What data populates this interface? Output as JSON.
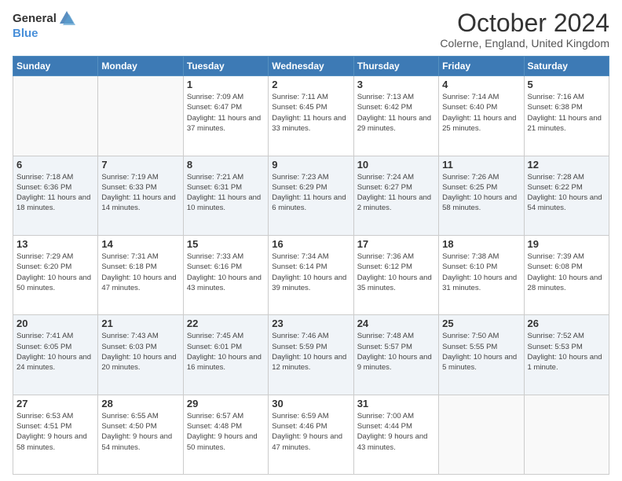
{
  "header": {
    "logo_general": "General",
    "logo_blue": "Blue",
    "title": "October 2024",
    "subtitle": "Colerne, England, United Kingdom"
  },
  "days_of_week": [
    "Sunday",
    "Monday",
    "Tuesday",
    "Wednesday",
    "Thursday",
    "Friday",
    "Saturday"
  ],
  "weeks": [
    [
      {
        "day": "",
        "info": ""
      },
      {
        "day": "",
        "info": ""
      },
      {
        "day": "1",
        "info": "Sunrise: 7:09 AM\nSunset: 6:47 PM\nDaylight: 11 hours and 37 minutes."
      },
      {
        "day": "2",
        "info": "Sunrise: 7:11 AM\nSunset: 6:45 PM\nDaylight: 11 hours and 33 minutes."
      },
      {
        "day": "3",
        "info": "Sunrise: 7:13 AM\nSunset: 6:42 PM\nDaylight: 11 hours and 29 minutes."
      },
      {
        "day": "4",
        "info": "Sunrise: 7:14 AM\nSunset: 6:40 PM\nDaylight: 11 hours and 25 minutes."
      },
      {
        "day": "5",
        "info": "Sunrise: 7:16 AM\nSunset: 6:38 PM\nDaylight: 11 hours and 21 minutes."
      }
    ],
    [
      {
        "day": "6",
        "info": "Sunrise: 7:18 AM\nSunset: 6:36 PM\nDaylight: 11 hours and 18 minutes."
      },
      {
        "day": "7",
        "info": "Sunrise: 7:19 AM\nSunset: 6:33 PM\nDaylight: 11 hours and 14 minutes."
      },
      {
        "day": "8",
        "info": "Sunrise: 7:21 AM\nSunset: 6:31 PM\nDaylight: 11 hours and 10 minutes."
      },
      {
        "day": "9",
        "info": "Sunrise: 7:23 AM\nSunset: 6:29 PM\nDaylight: 11 hours and 6 minutes."
      },
      {
        "day": "10",
        "info": "Sunrise: 7:24 AM\nSunset: 6:27 PM\nDaylight: 11 hours and 2 minutes."
      },
      {
        "day": "11",
        "info": "Sunrise: 7:26 AM\nSunset: 6:25 PM\nDaylight: 10 hours and 58 minutes."
      },
      {
        "day": "12",
        "info": "Sunrise: 7:28 AM\nSunset: 6:22 PM\nDaylight: 10 hours and 54 minutes."
      }
    ],
    [
      {
        "day": "13",
        "info": "Sunrise: 7:29 AM\nSunset: 6:20 PM\nDaylight: 10 hours and 50 minutes."
      },
      {
        "day": "14",
        "info": "Sunrise: 7:31 AM\nSunset: 6:18 PM\nDaylight: 10 hours and 47 minutes."
      },
      {
        "day": "15",
        "info": "Sunrise: 7:33 AM\nSunset: 6:16 PM\nDaylight: 10 hours and 43 minutes."
      },
      {
        "day": "16",
        "info": "Sunrise: 7:34 AM\nSunset: 6:14 PM\nDaylight: 10 hours and 39 minutes."
      },
      {
        "day": "17",
        "info": "Sunrise: 7:36 AM\nSunset: 6:12 PM\nDaylight: 10 hours and 35 minutes."
      },
      {
        "day": "18",
        "info": "Sunrise: 7:38 AM\nSunset: 6:10 PM\nDaylight: 10 hours and 31 minutes."
      },
      {
        "day": "19",
        "info": "Sunrise: 7:39 AM\nSunset: 6:08 PM\nDaylight: 10 hours and 28 minutes."
      }
    ],
    [
      {
        "day": "20",
        "info": "Sunrise: 7:41 AM\nSunset: 6:05 PM\nDaylight: 10 hours and 24 minutes."
      },
      {
        "day": "21",
        "info": "Sunrise: 7:43 AM\nSunset: 6:03 PM\nDaylight: 10 hours and 20 minutes."
      },
      {
        "day": "22",
        "info": "Sunrise: 7:45 AM\nSunset: 6:01 PM\nDaylight: 10 hours and 16 minutes."
      },
      {
        "day": "23",
        "info": "Sunrise: 7:46 AM\nSunset: 5:59 PM\nDaylight: 10 hours and 12 minutes."
      },
      {
        "day": "24",
        "info": "Sunrise: 7:48 AM\nSunset: 5:57 PM\nDaylight: 10 hours and 9 minutes."
      },
      {
        "day": "25",
        "info": "Sunrise: 7:50 AM\nSunset: 5:55 PM\nDaylight: 10 hours and 5 minutes."
      },
      {
        "day": "26",
        "info": "Sunrise: 7:52 AM\nSunset: 5:53 PM\nDaylight: 10 hours and 1 minute."
      }
    ],
    [
      {
        "day": "27",
        "info": "Sunrise: 6:53 AM\nSunset: 4:51 PM\nDaylight: 9 hours and 58 minutes."
      },
      {
        "day": "28",
        "info": "Sunrise: 6:55 AM\nSunset: 4:50 PM\nDaylight: 9 hours and 54 minutes."
      },
      {
        "day": "29",
        "info": "Sunrise: 6:57 AM\nSunset: 4:48 PM\nDaylight: 9 hours and 50 minutes."
      },
      {
        "day": "30",
        "info": "Sunrise: 6:59 AM\nSunset: 4:46 PM\nDaylight: 9 hours and 47 minutes."
      },
      {
        "day": "31",
        "info": "Sunrise: 7:00 AM\nSunset: 4:44 PM\nDaylight: 9 hours and 43 minutes."
      },
      {
        "day": "",
        "info": ""
      },
      {
        "day": "",
        "info": ""
      }
    ]
  ]
}
